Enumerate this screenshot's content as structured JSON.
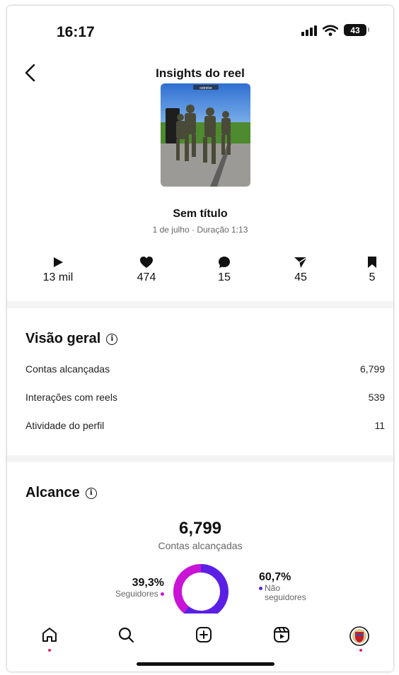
{
  "status": {
    "time": "16:17",
    "battery": "43"
  },
  "header": {
    "title": "Insights do reel"
  },
  "reel": {
    "title": "Sem título",
    "meta": "1 de julho · Duração 1:13",
    "thumb_caption": "ostrelve"
  },
  "stats": [
    {
      "icon": "play-icon",
      "value": "13 mil"
    },
    {
      "icon": "heart-icon",
      "value": "474"
    },
    {
      "icon": "comment-icon",
      "value": "15"
    },
    {
      "icon": "share-icon",
      "value": "45"
    },
    {
      "icon": "bookmark-icon",
      "value": "5"
    }
  ],
  "overview": {
    "title": "Visão geral",
    "rows": [
      {
        "label": "Contas alcançadas",
        "value": "6,799"
      },
      {
        "label": "Interações com reels",
        "value": "539"
      },
      {
        "label": "Atividade do perfil",
        "value": "11"
      }
    ]
  },
  "reach": {
    "title": "Alcance",
    "value": "6,799",
    "label": "Contas alcançadas",
    "followers_pct": "39,3%",
    "followers_label": "Seguidores",
    "followers_fraction": 0.393,
    "non_followers_pct": "60,7%",
    "non_followers_label_1": "Não",
    "non_followers_label_2": "seguidores",
    "non_followers_fraction": 0.607
  },
  "colors": {
    "followers": "#c913d6",
    "non_followers": "#5b1fe6",
    "notification": "#e0245e"
  },
  "nav": [
    "home-icon",
    "search-icon",
    "create-icon",
    "reels-icon",
    "profile-avatar"
  ]
}
